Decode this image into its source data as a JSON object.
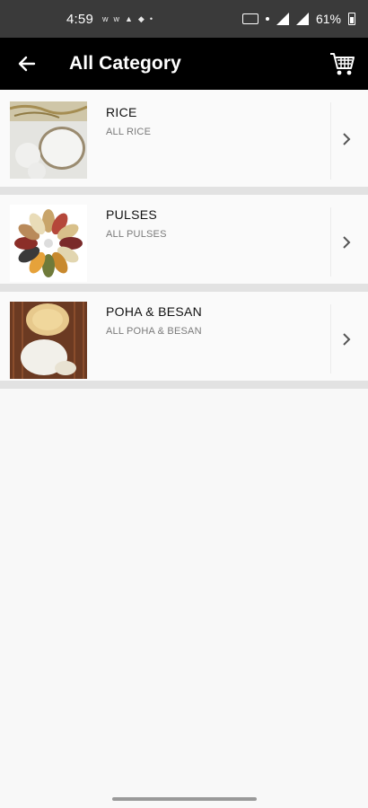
{
  "status_bar": {
    "time": "4:59",
    "notifications": [
      "w",
      "w",
      "▲",
      "◆",
      "•"
    ],
    "battery": "61%"
  },
  "app_bar": {
    "back_icon": "arrow-left-icon",
    "title": "All Category",
    "cart_icon": "cart-icon"
  },
  "categories": [
    {
      "name": "RICE",
      "subtitle": "ALL RICE"
    },
    {
      "name": "PULSES",
      "subtitle": "ALL PULSES"
    },
    {
      "name": "POHA & BESAN",
      "subtitle": "ALL POHA & BESAN"
    }
  ],
  "colors": {
    "app_bar": "#000000",
    "status_bar": "#3a3a3a",
    "background": "#f8f8f8",
    "separator": "#e2e2e2"
  }
}
